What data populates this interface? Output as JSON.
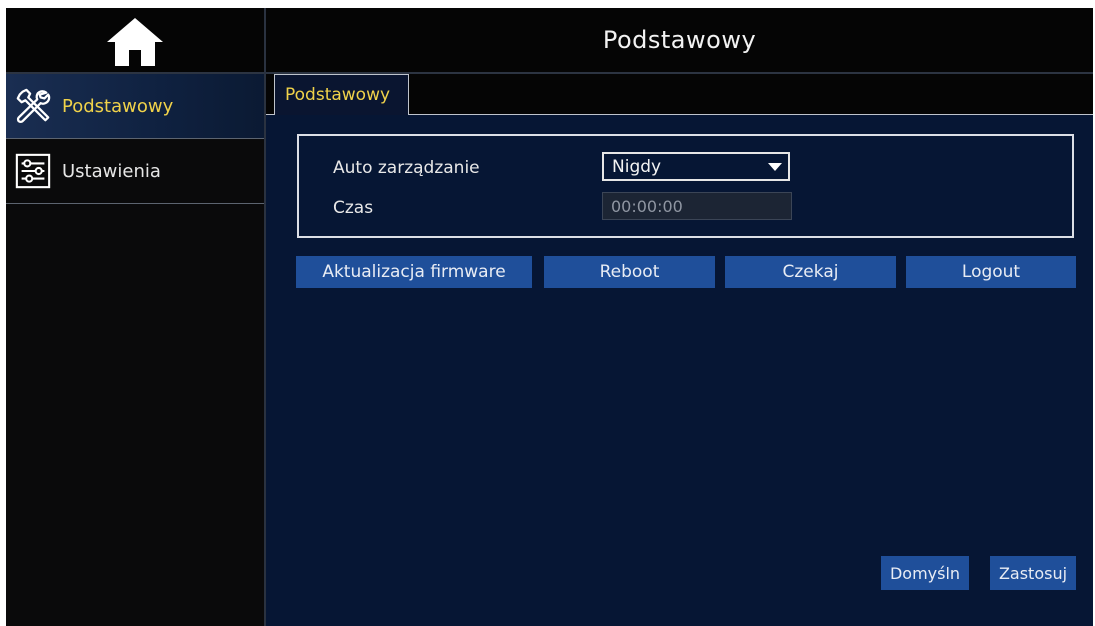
{
  "header": {
    "title": "Podstawowy"
  },
  "sidebar": {
    "home_icon": "home-icon",
    "items": [
      {
        "label": "Podstawowy",
        "icon": "tools-icon",
        "active": true
      },
      {
        "label": "Ustawienia",
        "icon": "sliders-icon",
        "active": false
      }
    ]
  },
  "tabs": [
    {
      "label": "Podstawowy",
      "active": true
    }
  ],
  "form": {
    "auto_label": "Auto zarządzanie",
    "auto_value": "Nigdy",
    "time_label": "Czas",
    "time_value": "00:00:00"
  },
  "actions": {
    "firmware": "Aktualizacja firmware",
    "reboot": "Reboot",
    "wait": "Czekaj",
    "logout": "Logout"
  },
  "footer": {
    "default": "Domyśln",
    "apply": "Zastosuj"
  },
  "colors": {
    "background": "#061634",
    "sidebar": "#0a0a0b",
    "accent_text": "#f0d24a",
    "button": "#1f4f9a"
  }
}
